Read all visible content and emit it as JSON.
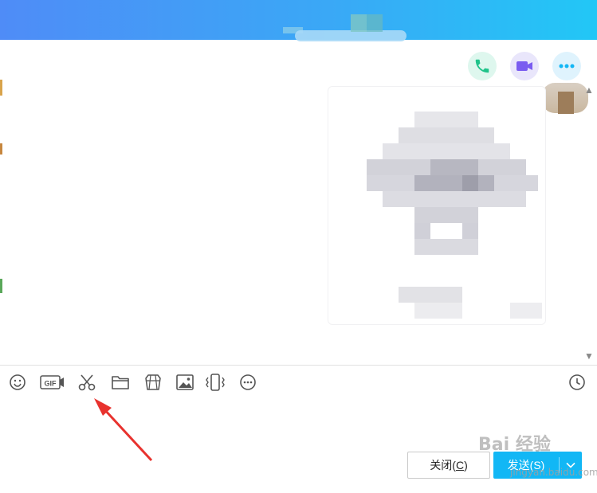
{
  "window": {
    "accent_gradient": [
      "#4f8cf7",
      "#22c7f6"
    ]
  },
  "header_actions": [
    {
      "name": "voice-call",
      "icon": "phone-icon",
      "color": "#20c38a"
    },
    {
      "name": "video-call",
      "icon": "video-camera-icon",
      "color": "#7a5cf0"
    },
    {
      "name": "more",
      "icon": "more-dots-icon",
      "color": "#12b7f5"
    }
  ],
  "toolbar": {
    "items": [
      {
        "name": "emoji",
        "icon": "smiley-icon"
      },
      {
        "name": "gif",
        "icon": "gif-icon",
        "label": "GIF"
      },
      {
        "name": "screenshot",
        "icon": "scissors-icon"
      },
      {
        "name": "send-file",
        "icon": "folder-icon"
      },
      {
        "name": "sticker",
        "icon": "sticker-icon"
      },
      {
        "name": "send-image",
        "icon": "image-icon"
      },
      {
        "name": "shake",
        "icon": "shake-phone-icon"
      },
      {
        "name": "more-tools",
        "icon": "more-circle-icon"
      },
      {
        "name": "history",
        "icon": "clock-icon"
      }
    ]
  },
  "footer": {
    "close_label": "关闭(",
    "close_accel": "C",
    "close_end": ")",
    "send_label": "发送(S)",
    "send_accent": "#12b7f5"
  },
  "watermark": {
    "main": "Bai 经验",
    "sub": "jingyan.baidu.com"
  }
}
